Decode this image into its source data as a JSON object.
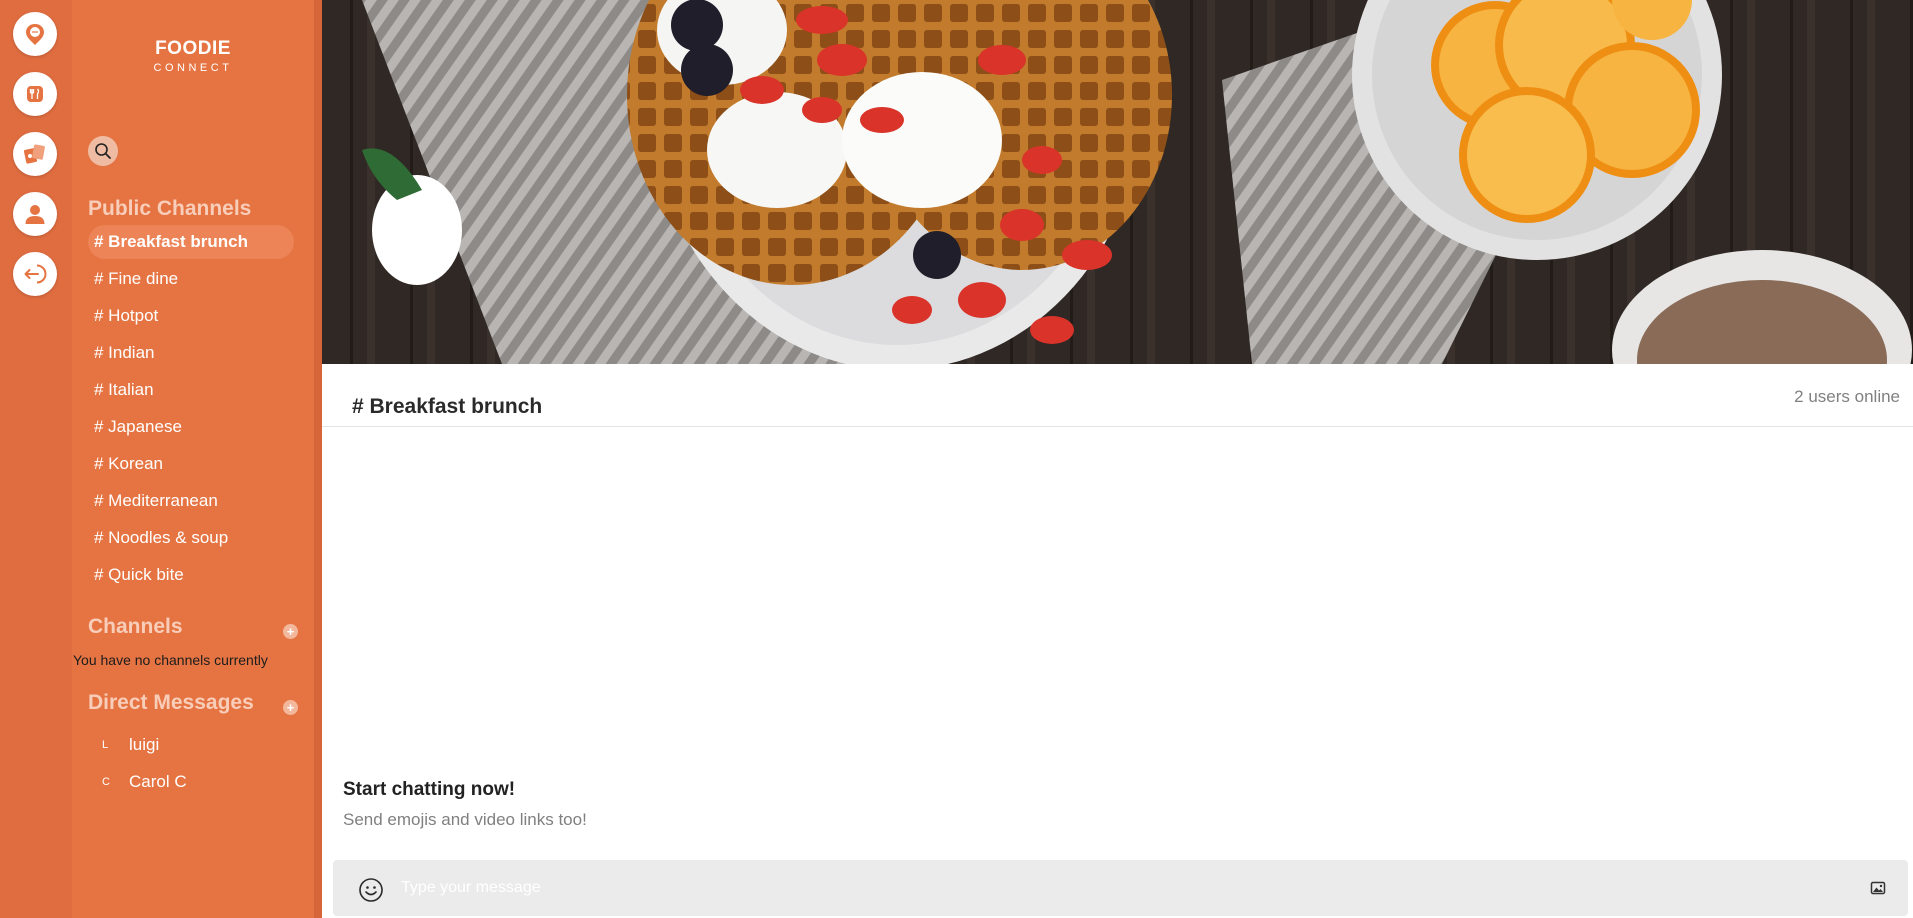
{
  "brand": {
    "name": "FOODIE",
    "tagline": "CONNECT"
  },
  "rail": {
    "items": [
      {
        "icon": "chat-bubble-pin-icon"
      },
      {
        "icon": "restaurant-icon"
      },
      {
        "icon": "tickets-icon"
      },
      {
        "icon": "user-profile-icon"
      },
      {
        "icon": "logout-icon"
      }
    ]
  },
  "sidebar": {
    "public_channels_title": "Public Channels",
    "public_channels": [
      {
        "label": "# Breakfast brunch",
        "active": true
      },
      {
        "label": "# Fine dine"
      },
      {
        "label": "# Hotpot"
      },
      {
        "label": "# Indian"
      },
      {
        "label": "# Italian"
      },
      {
        "label": "# Japanese"
      },
      {
        "label": "# Korean"
      },
      {
        "label": "# Mediterranean"
      },
      {
        "label": "# Noodles & soup"
      },
      {
        "label": "# Quick bite"
      }
    ],
    "channels_title": "Channels",
    "channels_add": "+",
    "no_channels_text": "You have no channels currently",
    "dm_title": "Direct Messages",
    "dm_add": "+",
    "direct_messages": [
      {
        "initial": "L",
        "name": "luigi"
      },
      {
        "initial": "C",
        "name": "Carol C"
      }
    ]
  },
  "main": {
    "channel_title": "# Breakfast brunch",
    "online_status": "2 users online",
    "start_title": "Start chatting now!",
    "start_subtitle": "Send emojis and video links too!",
    "composer_placeholder": "Type your message"
  },
  "colors": {
    "rail": "#e06d40",
    "sidebar": "#e57442",
    "active_channel": "#ec8457",
    "section_title": "#f8cdb9",
    "composer": "#ebebeb"
  }
}
